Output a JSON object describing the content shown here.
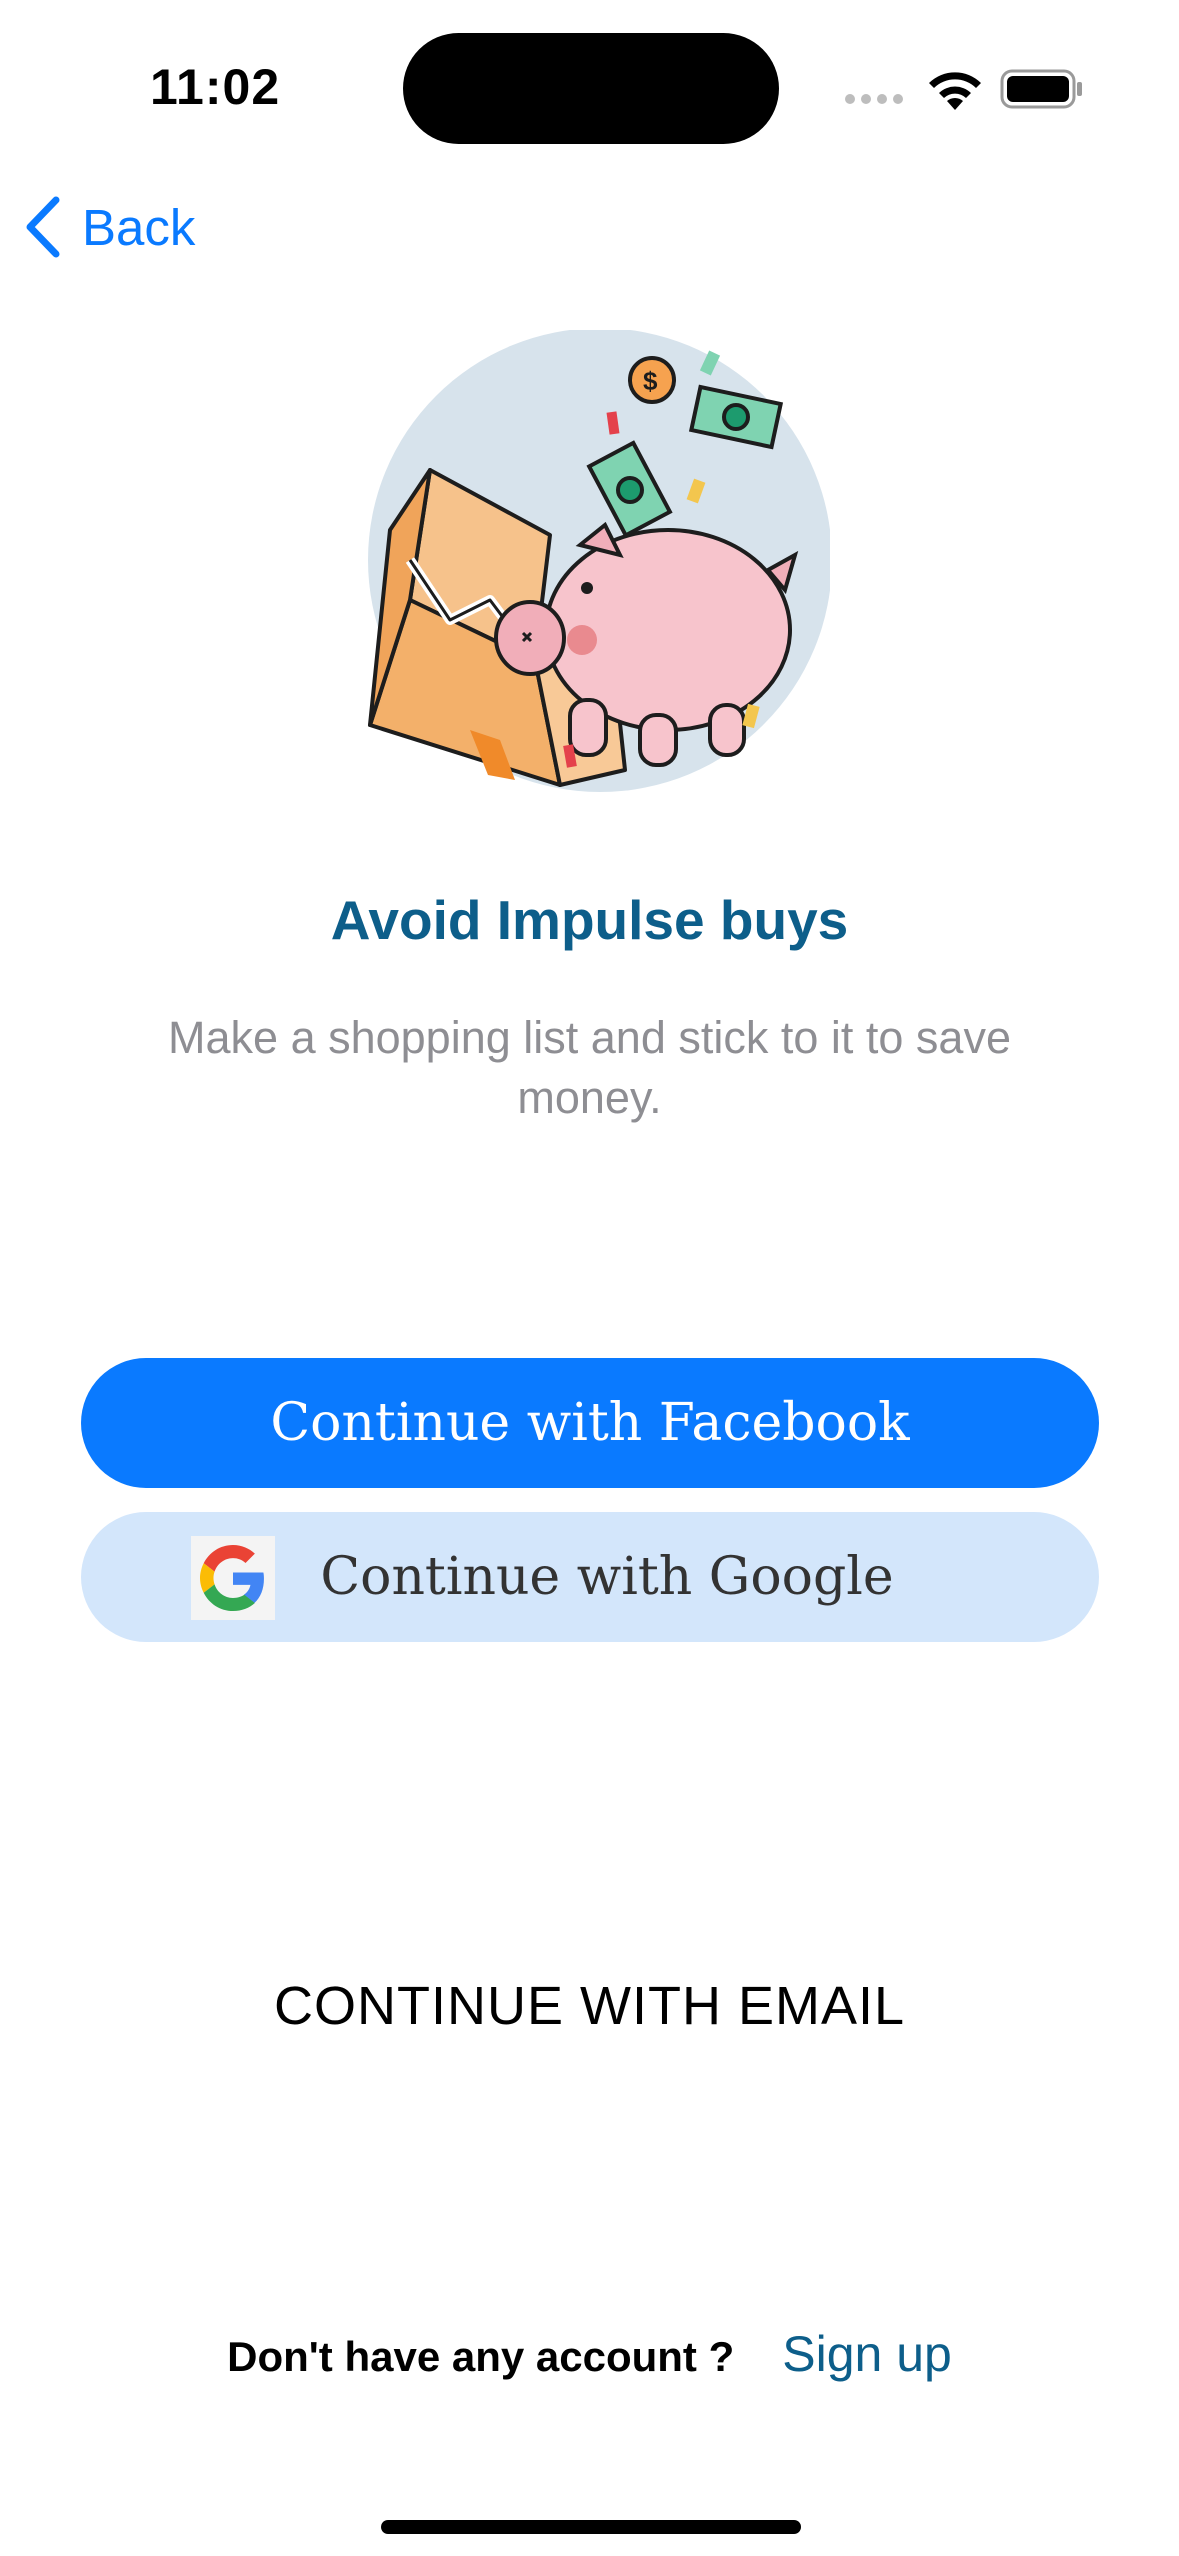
{
  "status_bar": {
    "time": "11:02"
  },
  "nav": {
    "back_label": "Back"
  },
  "onboarding": {
    "title": "Avoid Impulse buys",
    "subtitle": "Make a shopping list and stick to it to save money."
  },
  "buttons": {
    "facebook": "Continue with Facebook",
    "google": "Continue with Google",
    "email": "CONTINUE WITH EMAIL"
  },
  "footer": {
    "question": "Don't have any account ?",
    "signup": "Sign up"
  },
  "colors": {
    "accent": "#0a7aff",
    "title": "#0d5e8a",
    "google_button_bg": "#d3e6fb"
  },
  "icons": [
    "wifi-icon",
    "battery-icon",
    "chevron-left-icon",
    "google-logo-icon",
    "piggy-bank-illustration"
  ]
}
